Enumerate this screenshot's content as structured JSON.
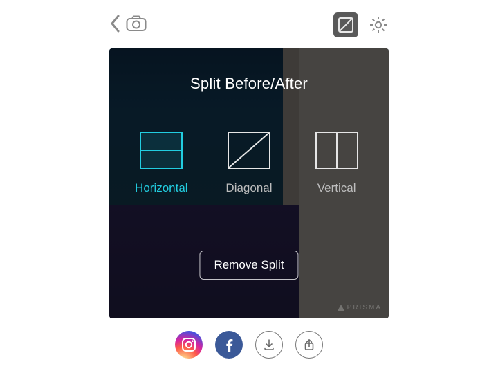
{
  "title": "Split Before/After",
  "options": {
    "horizontal": "Horizontal",
    "diagonal": "Diagonal",
    "vertical": "Vertical"
  },
  "remove_label": "Remove Split",
  "watermark": "PRISMA"
}
